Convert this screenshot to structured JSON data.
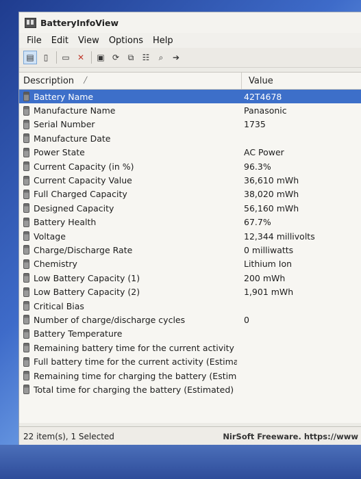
{
  "window": {
    "title": "BatteryInfoView"
  },
  "menu": [
    "File",
    "Edit",
    "View",
    "Options",
    "Help"
  ],
  "toolbar": {
    "icons": [
      "properties-icon",
      "html-report-icon",
      "options-icon",
      "delete-icon",
      "save-icon",
      "refresh-icon",
      "copy-icon",
      "properties-window-icon",
      "find-icon",
      "exit-icon"
    ]
  },
  "columns": {
    "description": "Description",
    "value": "Value"
  },
  "rows": [
    {
      "description": "Battery Name",
      "value": "42T4678"
    },
    {
      "description": "Manufacture Name",
      "value": "Panasonic"
    },
    {
      "description": "Serial Number",
      "value": "1735"
    },
    {
      "description": "Manufacture Date",
      "value": ""
    },
    {
      "description": "Power State",
      "value": "AC Power"
    },
    {
      "description": "Current Capacity (in %)",
      "value": "96.3%"
    },
    {
      "description": "Current Capacity Value",
      "value": "36,610 mWh"
    },
    {
      "description": "Full Charged Capacity",
      "value": "38,020 mWh"
    },
    {
      "description": "Designed Capacity",
      "value": "56,160 mWh"
    },
    {
      "description": "Battery Health",
      "value": "67.7%"
    },
    {
      "description": "Voltage",
      "value": "12,344 millivolts"
    },
    {
      "description": "Charge/Discharge Rate",
      "value": "0 milliwatts"
    },
    {
      "description": "Chemistry",
      "value": "Lithium Ion"
    },
    {
      "description": "Low Battery Capacity (1)",
      "value": "200 mWh"
    },
    {
      "description": "Low Battery Capacity (2)",
      "value": "1,901 mWh"
    },
    {
      "description": "Critical Bias",
      "value": ""
    },
    {
      "description": "Number of charge/discharge cycles",
      "value": "0"
    },
    {
      "description": "Battery Temperature",
      "value": ""
    },
    {
      "description": "Remaining battery time for the current activity (Est...",
      "value": ""
    },
    {
      "description": "Full battery time for the current activity (Estimated)",
      "value": ""
    },
    {
      "description": "Remaining time for charging the battery (Estimated)",
      "value": ""
    },
    {
      "description": "Total  time for charging the battery (Estimated)",
      "value": ""
    }
  ],
  "selected_index": 0,
  "status": {
    "left": "22 item(s), 1 Selected",
    "right": "NirSoft Freeware. https://www"
  }
}
